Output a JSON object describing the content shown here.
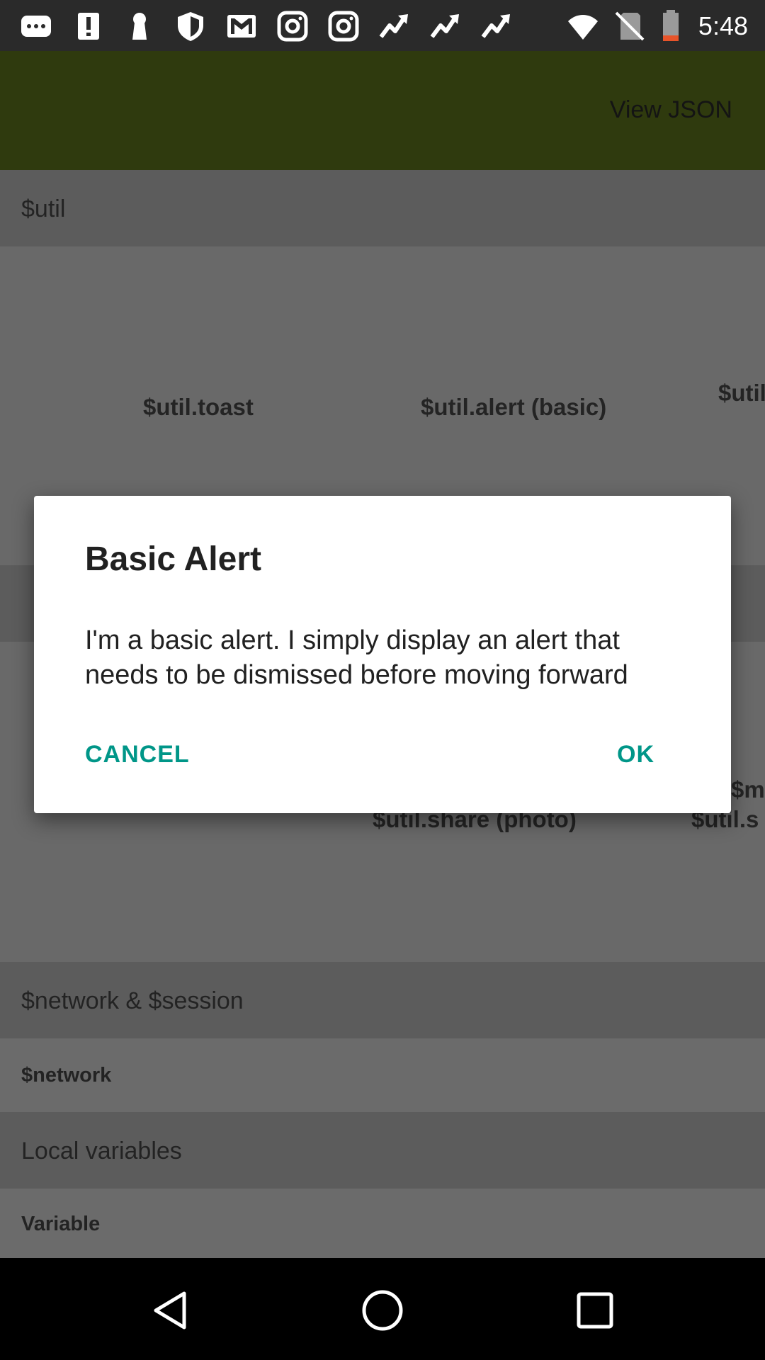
{
  "status_bar": {
    "time": "5:48",
    "icons": [
      "message-icon",
      "alert-icon",
      "keyhole-icon",
      "shield-icon",
      "gmail-icon",
      "instagram-icon",
      "instagram-icon",
      "trending-icon",
      "trending-icon",
      "trending-icon",
      "wifi-icon",
      "no-sim-icon",
      "battery-low-icon"
    ]
  },
  "app_bar": {
    "action": "View JSON",
    "color": "#3d4b12"
  },
  "sections": {
    "util": {
      "header": "$util",
      "items": [
        "$util.toast",
        "$util.alert (basic)",
        "$util"
      ]
    },
    "util_row2": {
      "items": [
        "$util.share (photo)",
        "$medi",
        "$util.s"
      ]
    },
    "network_session": {
      "header": "$network & $session",
      "row": "$network"
    },
    "local_vars": {
      "header": "Local variables",
      "row": "Variable"
    }
  },
  "dialog": {
    "title": "Basic Alert",
    "message": "I'm a basic alert. I simply display an alert that needs to be dismissed before moving forward",
    "cancel": "CANCEL",
    "ok": "OK",
    "accent": "#009688"
  },
  "nav_bar": {
    "icons": [
      "back-icon",
      "home-icon",
      "recents-icon"
    ]
  }
}
